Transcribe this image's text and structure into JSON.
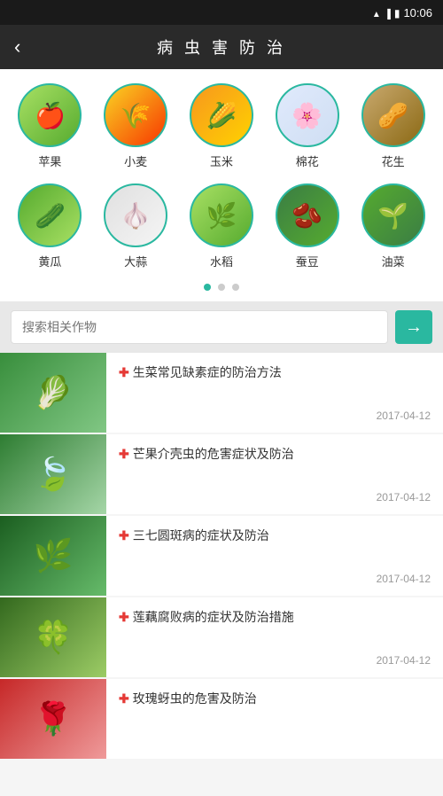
{
  "statusBar": {
    "time": "10:06"
  },
  "header": {
    "backLabel": "‹",
    "title": "病 虫 害 防 治"
  },
  "crops": [
    {
      "id": "apple",
      "label": "苹果",
      "emoji": "🍎",
      "bgClass": "apple-bg"
    },
    {
      "id": "wheat",
      "label": "小麦",
      "emoji": "🌾",
      "bgClass": "wheat-bg"
    },
    {
      "id": "corn",
      "label": "玉米",
      "emoji": "🌽",
      "bgClass": "corn-bg"
    },
    {
      "id": "cotton",
      "label": "棉花",
      "emoji": "🌸",
      "bgClass": "cotton-bg"
    },
    {
      "id": "peanut",
      "label": "花生",
      "emoji": "🥜",
      "bgClass": "peanut-bg"
    },
    {
      "id": "cucumber",
      "label": "黄瓜",
      "emoji": "🥒",
      "bgClass": "cucumber-bg"
    },
    {
      "id": "garlic",
      "label": "大蒜",
      "emoji": "🧄",
      "bgClass": "garlic-bg"
    },
    {
      "id": "rice",
      "label": "水稻",
      "emoji": "🌿",
      "bgClass": "rice-bg"
    },
    {
      "id": "pea",
      "label": "蚕豆",
      "emoji": "🫘",
      "bgClass": "pea-bg"
    },
    {
      "id": "rape",
      "label": "油菜",
      "emoji": "🌱",
      "bgClass": "rape-bg"
    }
  ],
  "pagination": {
    "dots": [
      true,
      false,
      false
    ]
  },
  "search": {
    "placeholder": "搜索相关作物",
    "buttonArrow": "→"
  },
  "articles": [
    {
      "id": 1,
      "title": "生菜常见缺素症的防治方法",
      "date": "2017-04-12",
      "thumbClass": "thumb-green1",
      "thumbEmoji": "🥬"
    },
    {
      "id": 2,
      "title": "芒果介壳虫的危害症状及防治",
      "date": "2017-04-12",
      "thumbClass": "thumb-green2",
      "thumbEmoji": "🍃"
    },
    {
      "id": 3,
      "title": "三七圆斑病的症状及防治",
      "date": "2017-04-12",
      "thumbClass": "thumb-green3",
      "thumbEmoji": "🌿"
    },
    {
      "id": 4,
      "title": "莲藕腐败病的症状及防治措施",
      "date": "2017-04-12",
      "thumbClass": "thumb-green4",
      "thumbEmoji": "🍀"
    },
    {
      "id": 5,
      "title": "玫瑰蚜虫的危害及防治",
      "date": "",
      "thumbClass": "thumb-red1",
      "thumbEmoji": "🌹"
    }
  ],
  "crossSymbol": "✚"
}
